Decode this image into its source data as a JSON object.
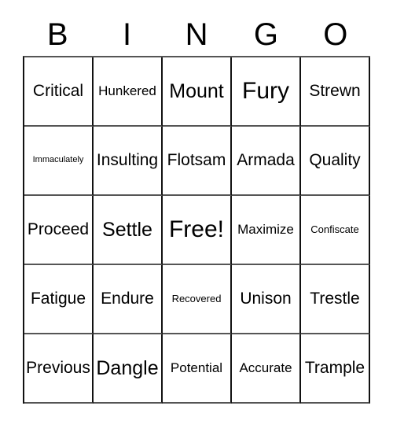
{
  "card": {
    "title": "BINGO card",
    "header": {
      "letters": [
        "B",
        "I",
        "N",
        "G",
        "O"
      ]
    },
    "free_space": "Free!",
    "columns": 5,
    "rows": 5,
    "border_color": "#111111",
    "text_color": "#000000",
    "background_color": "#ffffff",
    "grid": [
      [
        {
          "label": "Critical",
          "size": "fs-md"
        },
        {
          "label": "Hunkered",
          "size": "fs-sm"
        },
        {
          "label": "Mount",
          "size": "fs-lg"
        },
        {
          "label": "Fury",
          "size": "fs-xl"
        },
        {
          "label": "Strewn",
          "size": "fs-md"
        }
      ],
      [
        {
          "label": "Immaculately",
          "size": "fs-xxs"
        },
        {
          "label": "Insulting",
          "size": "fs-md"
        },
        {
          "label": "Flotsam",
          "size": "fs-md"
        },
        {
          "label": "Armada",
          "size": "fs-md"
        },
        {
          "label": "Quality",
          "size": "fs-md"
        }
      ],
      [
        {
          "label": "Proceed",
          "size": "fs-md"
        },
        {
          "label": "Settle",
          "size": "fs-lg"
        },
        {
          "label": "Free!",
          "size": "fs-xl"
        },
        {
          "label": "Maximize",
          "size": "fs-sm"
        },
        {
          "label": "Confiscate",
          "size": "fs-xs"
        }
      ],
      [
        {
          "label": "Fatigue",
          "size": "fs-md"
        },
        {
          "label": "Endure",
          "size": "fs-md"
        },
        {
          "label": "Recovered",
          "size": "fs-xs"
        },
        {
          "label": "Unison",
          "size": "fs-md"
        },
        {
          "label": "Trestle",
          "size": "fs-md"
        }
      ],
      [
        {
          "label": "Previous",
          "size": "fs-md"
        },
        {
          "label": "Dangle",
          "size": "fs-lg"
        },
        {
          "label": "Potential",
          "size": "fs-sm"
        },
        {
          "label": "Accurate",
          "size": "fs-sm"
        },
        {
          "label": "Trample",
          "size": "fs-md"
        }
      ]
    ]
  }
}
